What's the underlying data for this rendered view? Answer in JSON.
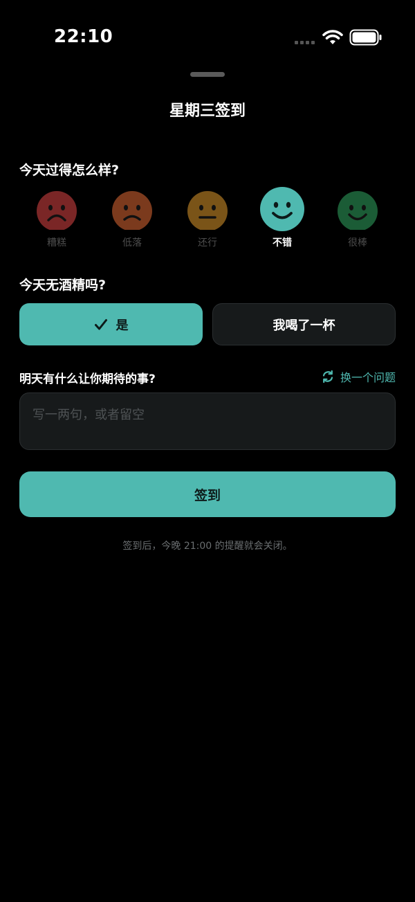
{
  "status_bar": {
    "time": "22:10"
  },
  "sheet": {
    "title": "星期三签到"
  },
  "mood": {
    "question": "今天过得怎么样?",
    "selected_index": 3,
    "options": [
      {
        "label": "糟糕",
        "face": "sad",
        "color": "#7a2626"
      },
      {
        "label": "低落",
        "face": "sad",
        "color": "#7b3a1d"
      },
      {
        "label": "还行",
        "face": "neutral",
        "color": "#7a5418"
      },
      {
        "label": "不错",
        "face": "happy",
        "color": "#4fb9b0"
      },
      {
        "label": "很棒",
        "face": "happy",
        "color": "#1b5c36"
      }
    ]
  },
  "alcohol": {
    "question": "今天无酒精吗?",
    "yes_label": "是",
    "no_label": "我喝了一杯",
    "selected": "yes"
  },
  "prompt": {
    "question": "明天有什么让你期待的事?",
    "switch_label": "换一个问题",
    "placeholder": "写一两句，或者留空",
    "value": ""
  },
  "submit": {
    "label": "签到"
  },
  "footnote": "签到后，今晚 21:00 的提醒就会关闭。",
  "colors": {
    "accent": "#4fb9b0",
    "background": "#000000",
    "card": "#171a1b"
  }
}
